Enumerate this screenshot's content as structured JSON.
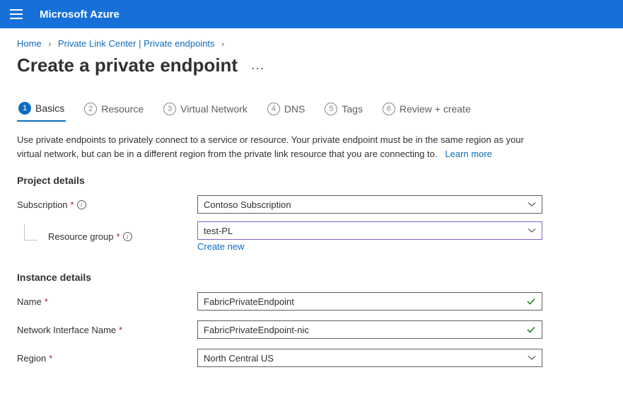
{
  "topbar": {
    "brand": "Microsoft Azure"
  },
  "breadcrumb": {
    "home": "Home",
    "plc": "Private Link Center | Private endpoints"
  },
  "title": "Create a private endpoint",
  "tabs": [
    {
      "num": "1",
      "label": "Basics"
    },
    {
      "num": "2",
      "label": "Resource"
    },
    {
      "num": "3",
      "label": "Virtual Network"
    },
    {
      "num": "4",
      "label": "DNS"
    },
    {
      "num": "5",
      "label": "Tags"
    },
    {
      "num": "6",
      "label": "Review + create"
    }
  ],
  "intro": {
    "text": "Use private endpoints to privately connect to a service or resource. Your private endpoint must be in the same region as your virtual network, but can be in a different region from the private link resource that you are connecting to.",
    "learn": "Learn more"
  },
  "sections": {
    "project": "Project details",
    "instance": "Instance details"
  },
  "fields": {
    "subscription": {
      "label": "Subscription",
      "value": "Contoso Subscription"
    },
    "resourceGroup": {
      "label": "Resource group",
      "value": "test-PL",
      "createNew": "Create new"
    },
    "name": {
      "label": "Name",
      "value": "FabricPrivateEndpoint"
    },
    "nic": {
      "label": "Network Interface Name",
      "value": "FabricPrivateEndpoint-nic"
    },
    "region": {
      "label": "Region",
      "value": "North Central US"
    }
  }
}
